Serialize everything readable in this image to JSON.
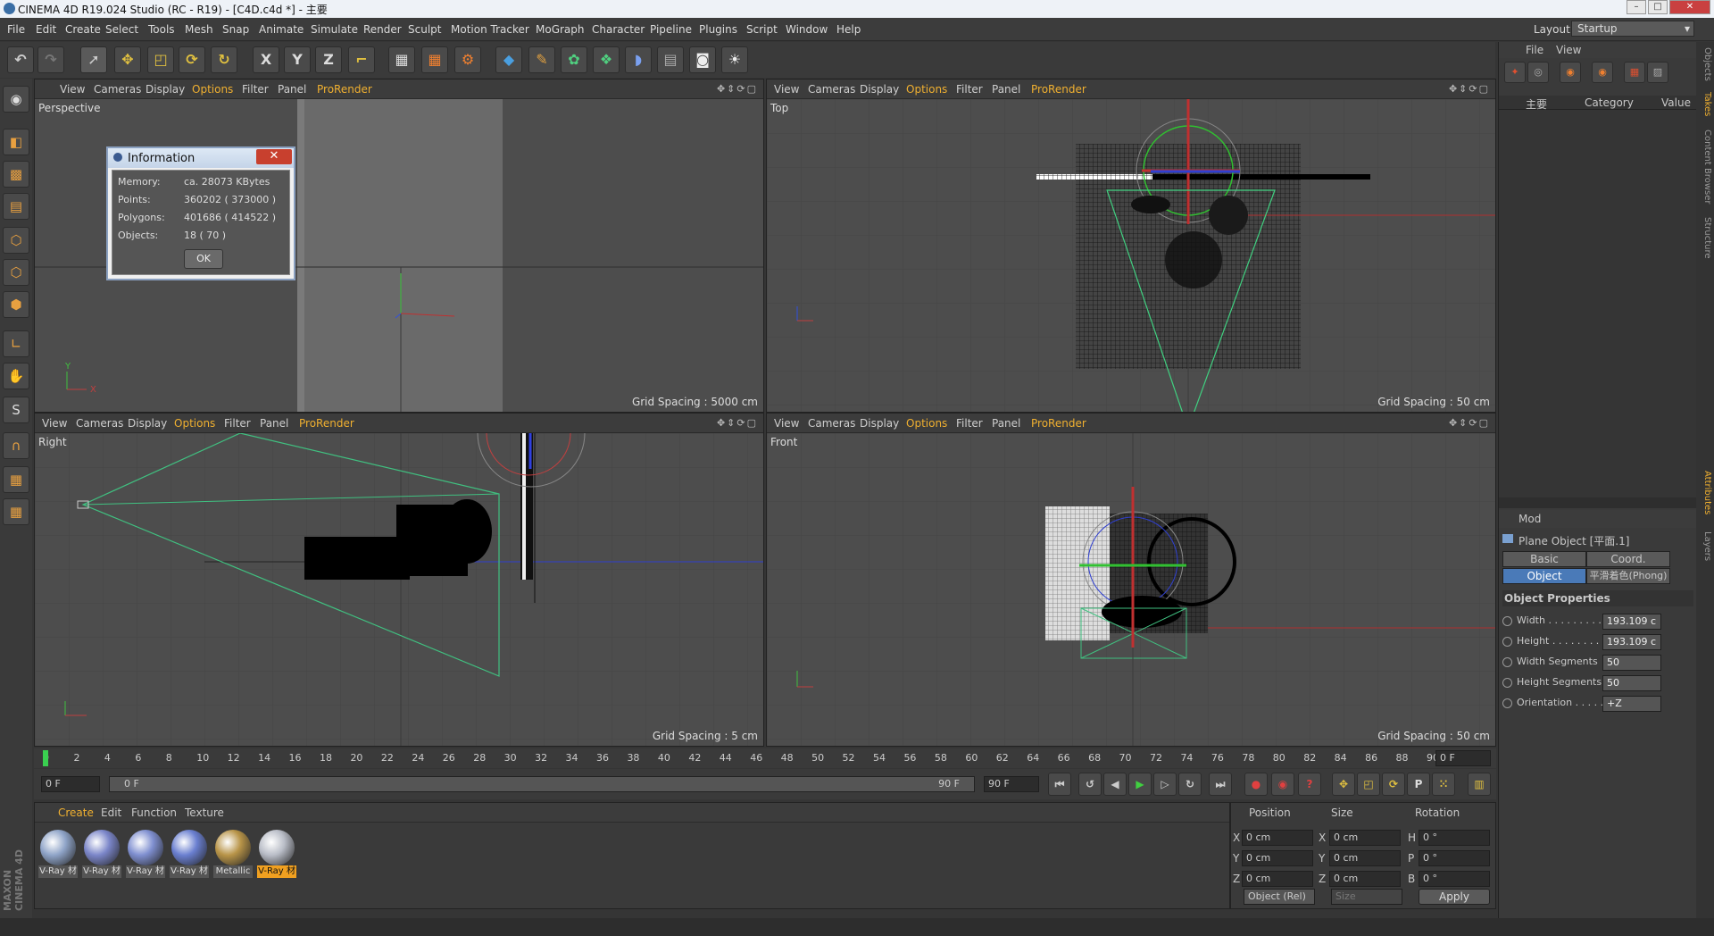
{
  "window": {
    "title": "CINEMA 4D R19.024 Studio (RC - R19) - [C4D.c4d *] - 主要"
  },
  "menu": {
    "items": [
      "File",
      "Edit",
      "Create",
      "Select",
      "Tools",
      "Mesh",
      "Snap",
      "Animate",
      "Simulate",
      "Render",
      "Sculpt",
      "Motion Tracker",
      "MoGraph",
      "Character",
      "Pipeline",
      "Plugins",
      "Script",
      "Window",
      "Help"
    ]
  },
  "layout": {
    "label": "Layout:",
    "value": "Startup"
  },
  "viewport_menu": [
    "View",
    "Cameras",
    "Display",
    "Options",
    "Filter",
    "Panel",
    "ProRender"
  ],
  "viewports": {
    "perspective": {
      "name": "Perspective",
      "grid": "Grid Spacing : 5000 cm"
    },
    "top": {
      "name": "Top",
      "grid": "Grid Spacing : 50 cm"
    },
    "right": {
      "name": "Right",
      "grid": "Grid Spacing : 5 cm"
    },
    "front": {
      "name": "Front",
      "grid": "Grid Spacing : 50 cm"
    }
  },
  "info_dialog": {
    "title": "Information",
    "rows": [
      {
        "label": "Memory:",
        "value": "ca. 28073 KBytes"
      },
      {
        "label": "Points:",
        "value": "360202 ( 373000 )"
      },
      {
        "label": "Polygons:",
        "value": "401686 ( 414522 )"
      },
      {
        "label": "Objects:",
        "value": "18 ( 70 )"
      }
    ],
    "ok": "OK"
  },
  "timeline": {
    "ticks": [
      "0",
      "2",
      "4",
      "6",
      "8",
      "10",
      "12",
      "14",
      "16",
      "18",
      "20",
      "22",
      "24",
      "26",
      "28",
      "30",
      "32",
      "34",
      "36",
      "38",
      "40",
      "42",
      "44",
      "46",
      "48",
      "50",
      "52",
      "54",
      "56",
      "58",
      "60",
      "62",
      "64",
      "66",
      "68",
      "70",
      "72",
      "74",
      "76",
      "78",
      "80",
      "82",
      "84",
      "86",
      "88",
      "90"
    ],
    "current": "0 F",
    "start": "0 F",
    "range_start": "0 F",
    "range_end": "90 F",
    "end": "90 F"
  },
  "material_manager": {
    "menu": [
      "Create",
      "Edit",
      "Function",
      "Texture"
    ],
    "materials": [
      {
        "label": "V-Ray 材",
        "color": "#8fa4c8"
      },
      {
        "label": "V-Ray 材",
        "color": "#7b86c9"
      },
      {
        "label": "V-Ray 材",
        "color": "#7f8fd0"
      },
      {
        "label": "V-Ray 材",
        "color": "#6a7fd0"
      },
      {
        "label": "Metallic",
        "color": "#b89448"
      },
      {
        "label": "V-Ray 材",
        "color": "#b9bdc7"
      }
    ]
  },
  "coord_manager": {
    "headers": [
      "Position",
      "Size",
      "Rotation"
    ],
    "rows": [
      {
        "axis": "X",
        "pos": "0 cm",
        "saxis": "X",
        "size": "0 cm",
        "raxis": "H",
        "rot": "0 °"
      },
      {
        "axis": "Y",
        "pos": "0 cm",
        "saxis": "Y",
        "size": "0 cm",
        "raxis": "P",
        "rot": "0 °"
      },
      {
        "axis": "Z",
        "pos": "0 cm",
        "saxis": "Z",
        "size": "0 cm",
        "raxis": "B",
        "rot": "0 °"
      }
    ],
    "mode": "Object (Rel)",
    "size_mode": "Size",
    "apply": "Apply"
  },
  "object_manager": {
    "menu": [
      "File",
      "View"
    ],
    "col_name": "主要",
    "col_category": "Category",
    "col_value": "Value"
  },
  "attributes": {
    "menu": "Mod",
    "object": "Plane Object [平面.1]",
    "tabs": [
      "Basic",
      "Coord.",
      "Object",
      "平滑着色(Phong)"
    ],
    "section": "Object Properties",
    "props": [
      {
        "label": "Width . . . . . . . . .",
        "value": "193.109 c"
      },
      {
        "label": "Height . . . . . . . .",
        "value": "193.109 c"
      },
      {
        "label": "Width Segments",
        "value": "50"
      },
      {
        "label": "Height Segments",
        "value": "50"
      },
      {
        "label": "Orientation . . . . .",
        "value": "+Z"
      }
    ]
  },
  "right_strip": [
    "Objects",
    "Takes",
    "Content Browser",
    "Structure",
    "Attributes",
    "Layers"
  ],
  "brand": "MAXON CINEMA 4D"
}
